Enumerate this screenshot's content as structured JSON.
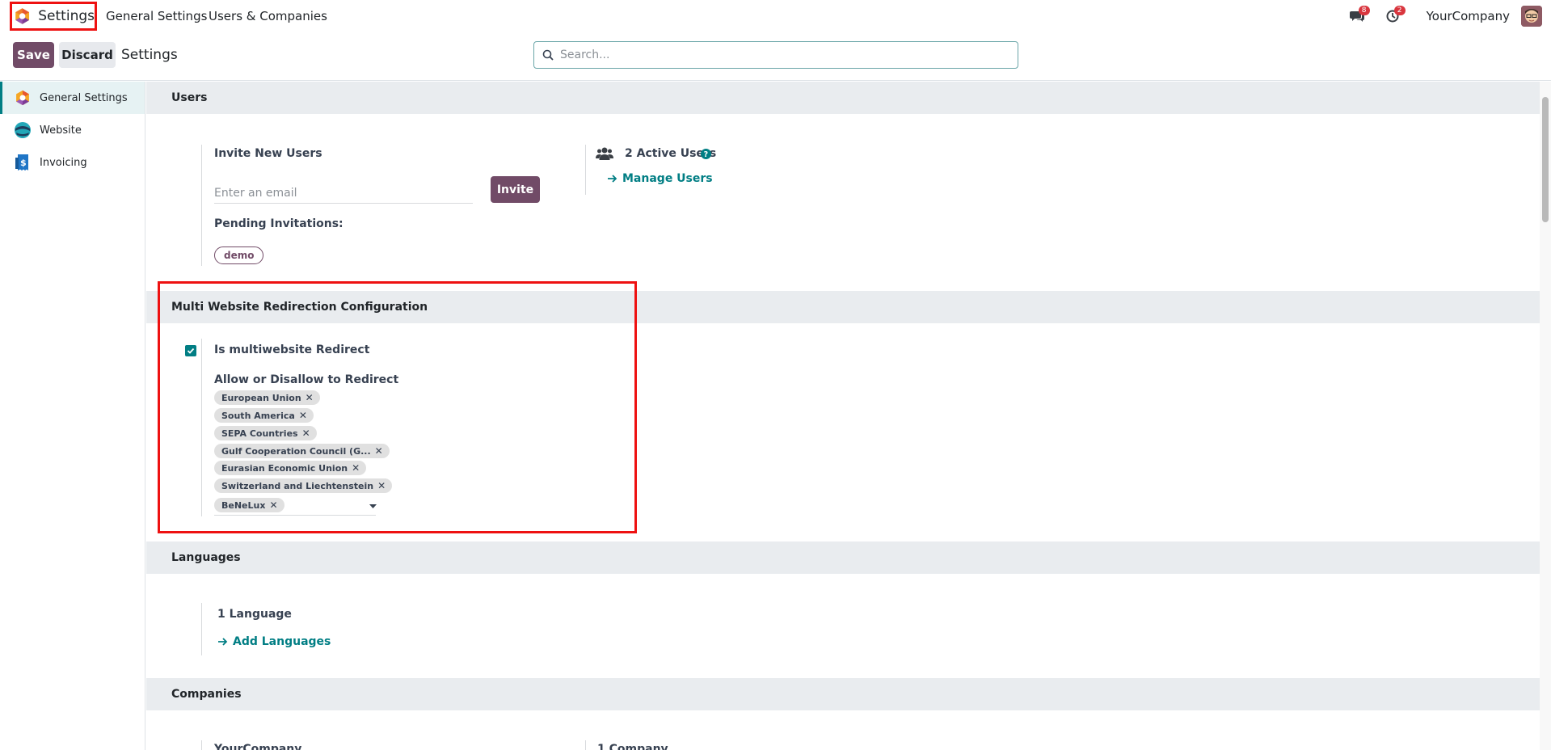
{
  "navbar": {
    "app_name": "Settings",
    "menu": [
      "General Settings",
      "Users & Companies"
    ],
    "messages_count": "8",
    "activities_count": "2",
    "company": "YourCompany"
  },
  "control": {
    "save_label": "Save",
    "discard_label": "Discard",
    "title": "Settings",
    "search_placeholder": "Search..."
  },
  "sidebar": {
    "items": [
      {
        "label": "General Settings",
        "icon": "settings-app-icon",
        "active": true
      },
      {
        "label": "Website",
        "icon": "website-app-icon"
      },
      {
        "label": "Invoicing",
        "icon": "invoicing-app-icon"
      }
    ]
  },
  "users": {
    "section_title": "Users",
    "invite_title": "Invite New Users",
    "email_placeholder": "Enter an email",
    "invite_button": "Invite",
    "pending_title": "Pending Invitations:",
    "pending": [
      "demo"
    ],
    "active_users": "2 Active Users",
    "manage_users": "Manage Users"
  },
  "multiwebsite": {
    "section_title": "Multi Website Redirection Configuration",
    "checkbox_label": "Is multiwebsite Redirect",
    "checked": true,
    "field_label": "Allow or Disallow to Redirect",
    "tags": [
      "European Union",
      "South America",
      "SEPA Countries",
      "Gulf Cooperation Council (G...",
      "Eurasian Economic Union",
      "Switzerland and Liechtenstein",
      "BeNeLux"
    ]
  },
  "languages": {
    "section_title": "Languages",
    "count": "1 Language",
    "add_link": "Add Languages"
  },
  "companies": {
    "section_title": "Companies",
    "company_name": "YourCompany",
    "company_count": "1 Company"
  },
  "colors": {
    "primary": "#714b67",
    "accent": "#017e84",
    "highlight": "#ee1111"
  }
}
